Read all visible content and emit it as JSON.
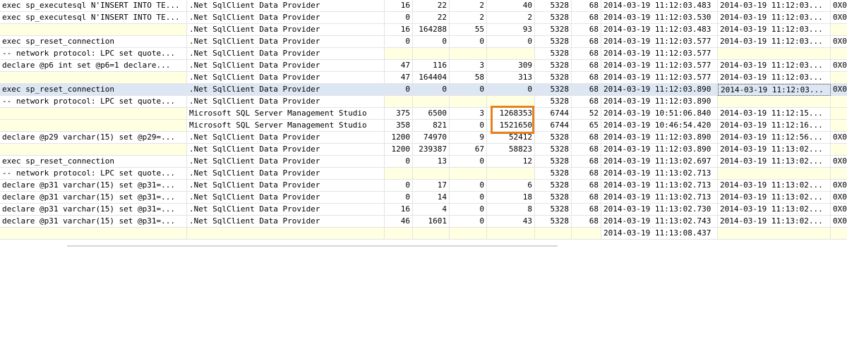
{
  "grid": {
    "rows": [
      {
        "cells": [
          "exec sp_executesql N'INSERT INTO TE...",
          ".Net SqlClient Data Provider",
          "16",
          "22",
          "2",
          "40",
          "5328",
          "68",
          "2014-03-19 11:12:03.483",
          "2014-03-19 11:12:03...",
          "0X0"
        ]
      },
      {
        "cells": [
          "exec sp_executesql N'INSERT INTO TE...",
          ".Net SqlClient Data Provider",
          "0",
          "22",
          "2",
          "2",
          "5328",
          "68",
          "2014-03-19 11:12:03.530",
          "2014-03-19 11:12:03...",
          "0X0"
        ]
      },
      {
        "cells": [
          "",
          ".Net SqlClient Data Provider",
          "16",
          "164288",
          "55",
          "93",
          "5328",
          "68",
          "2014-03-19 11:12:03.483",
          "2014-03-19 11:12:03...",
          ""
        ]
      },
      {
        "cells": [
          "exec sp_reset_connection",
          ".Net SqlClient Data Provider",
          "0",
          "0",
          "0",
          "0",
          "5328",
          "68",
          "2014-03-19 11:12:03.577",
          "2014-03-19 11:12:03...",
          "0X0"
        ]
      },
      {
        "cells": [
          "-- network protocol: LPC  set quote...",
          ".Net SqlClient Data Provider",
          "",
          "",
          "",
          "",
          "5328",
          "68",
          "2014-03-19 11:12:03.577",
          "",
          ""
        ]
      },
      {
        "cells": [
          "declare @p6 int  set @p6=1  declare...",
          ".Net SqlClient Data Provider",
          "47",
          "116",
          "3",
          "309",
          "5328",
          "68",
          "2014-03-19 11:12:03.577",
          "2014-03-19 11:12:03...",
          "0X0"
        ]
      },
      {
        "cells": [
          "",
          ".Net SqlClient Data Provider",
          "47",
          "164404",
          "58",
          "313",
          "5328",
          "68",
          "2014-03-19 11:12:03.577",
          "2014-03-19 11:12:03...",
          ""
        ]
      },
      {
        "cells": [
          "exec sp_reset_connection",
          ".Net SqlClient Data Provider",
          "0",
          "0",
          "0",
          "0",
          "5328",
          "68",
          "2014-03-19 11:12:03.890",
          "2014-03-19 11:12:03...",
          "0X0"
        ]
      },
      {
        "cells": [
          "-- network protocol: LPC  set quote...",
          ".Net SqlClient Data Provider",
          "",
          "",
          "",
          "",
          "5328",
          "68",
          "2014-03-19 11:12:03.890",
          "",
          ""
        ]
      },
      {
        "cells": [
          "",
          "Microsoft SQL Server Management Studio",
          "375",
          "6500",
          "3",
          "1268353",
          "6744",
          "52",
          "2014-03-19 10:51:06.840",
          "2014-03-19 11:12:15...",
          ""
        ]
      },
      {
        "cells": [
          "",
          "Microsoft SQL Server Management Studio",
          "358",
          "821",
          "0",
          "1521650",
          "6744",
          "65",
          "2014-03-19 10:46:54.420",
          "2014-03-19 11:12:16...",
          ""
        ]
      },
      {
        "cells": [
          "declare @p29 varchar(15)  set @p29=...",
          ".Net SqlClient Data Provider",
          "1200",
          "74970",
          "9",
          "52412",
          "5328",
          "68",
          "2014-03-19 11:12:03.890",
          "2014-03-19 11:12:56...",
          "0X0"
        ]
      },
      {
        "cells": [
          "",
          ".Net SqlClient Data Provider",
          "1200",
          "239387",
          "67",
          "58823",
          "5328",
          "68",
          "2014-03-19 11:12:03.890",
          "2014-03-19 11:13:02...",
          ""
        ]
      },
      {
        "cells": [
          "exec sp_reset_connection",
          ".Net SqlClient Data Provider",
          "0",
          "13",
          "0",
          "12",
          "5328",
          "68",
          "2014-03-19 11:13:02.697",
          "2014-03-19 11:13:02...",
          "0X0"
        ]
      },
      {
        "cells": [
          "-- network protocol: LPC  set quote...",
          ".Net SqlClient Data Provider",
          "",
          "",
          "",
          "",
          "5328",
          "68",
          "2014-03-19 11:13:02.713",
          "",
          ""
        ]
      },
      {
        "cells": [
          "declare @p31 varchar(15)  set @p31=...",
          ".Net SqlClient Data Provider",
          "0",
          "17",
          "0",
          "6",
          "5328",
          "68",
          "2014-03-19 11:13:02.713",
          "2014-03-19 11:13:02...",
          "0X0"
        ]
      },
      {
        "cells": [
          "declare @p31 varchar(15)  set @p31=...",
          ".Net SqlClient Data Provider",
          "0",
          "14",
          "0",
          "18",
          "5328",
          "68",
          "2014-03-19 11:13:02.713",
          "2014-03-19 11:13:02...",
          "0X0"
        ]
      },
      {
        "cells": [
          "declare @p31 varchar(15)  set @p31=...",
          ".Net SqlClient Data Provider",
          "16",
          "4",
          "0",
          "8",
          "5328",
          "68",
          "2014-03-19 11:13:02.730",
          "2014-03-19 11:13:02...",
          "0X0"
        ]
      },
      {
        "cells": [
          "declare @p31 varchar(15)  set @p31=...",
          ".Net SqlClient Data Provider",
          "46",
          "1601",
          "0",
          "43",
          "5328",
          "68",
          "2014-03-19 11:13:02.743",
          "2014-03-19 11:13:02...",
          "0X0"
        ]
      },
      {
        "cells": [
          "",
          "",
          "",
          "",
          "",
          "",
          "",
          "",
          "2014-03-19 11:13:08.437",
          "",
          ""
        ]
      }
    ],
    "selected_row": 7,
    "focused_column": 9
  },
  "colors": {
    "empty_cell": "#ffffe1",
    "selected_row": "#dde7f3",
    "highlight": "#e8811f"
  }
}
